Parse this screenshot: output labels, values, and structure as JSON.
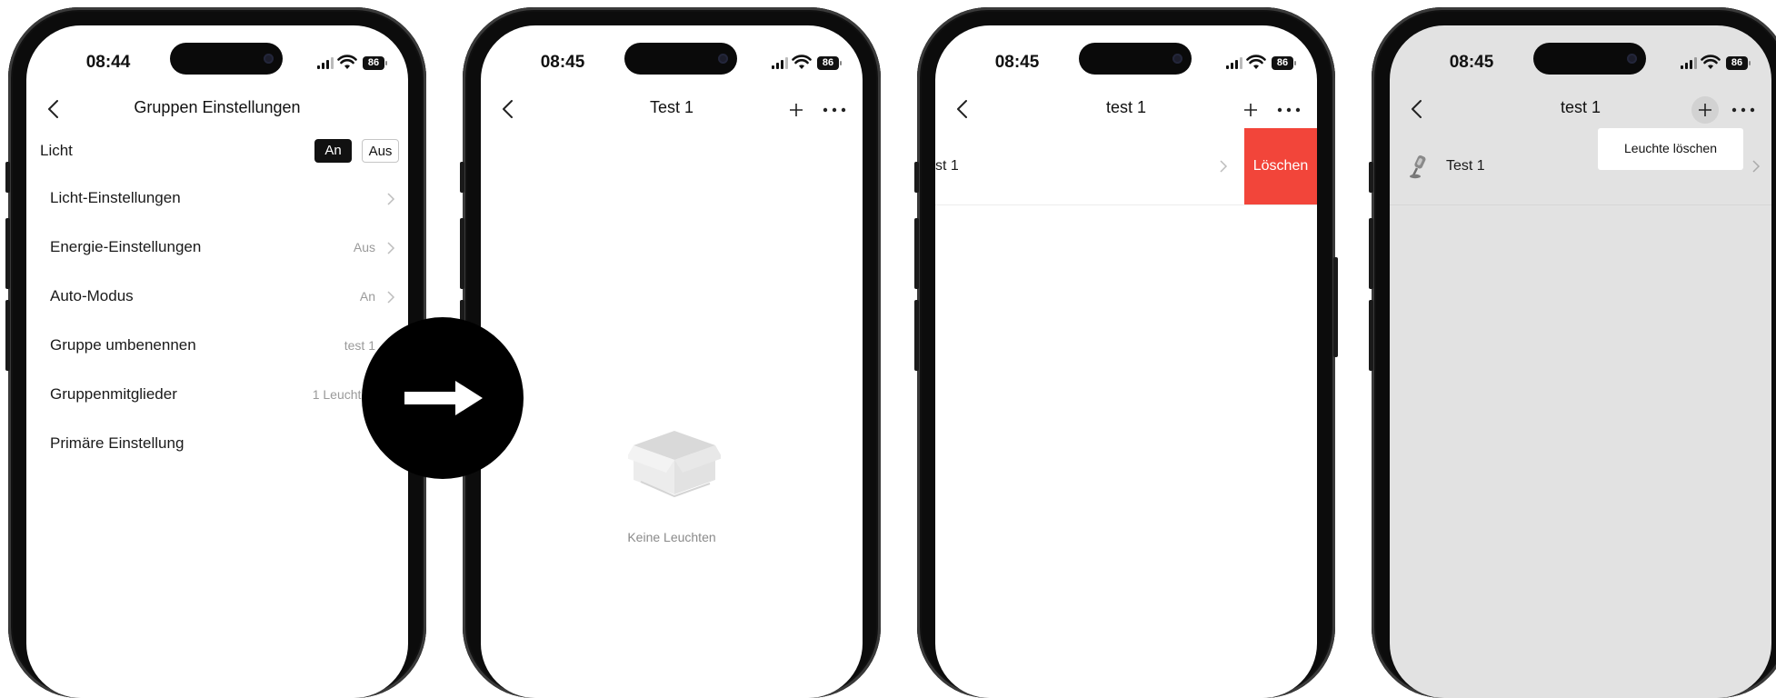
{
  "phones": [
    {
      "time": "08:44",
      "battery": "86",
      "nav": {
        "title": "Gruppen Einstellungen"
      },
      "light_row": {
        "label": "Licht",
        "on_label": "An",
        "off_label": "Aus"
      },
      "settings": [
        {
          "label": "Licht-Einstellungen",
          "value": ""
        },
        {
          "label": "Energie-Einstellungen",
          "value": "Aus"
        },
        {
          "label": "Auto-Modus",
          "value": "An"
        },
        {
          "label": "Gruppe umbenennen",
          "value": "test 1"
        },
        {
          "label": "Gruppenmitglieder",
          "value": "1 Leuchten"
        },
        {
          "label": "Primäre Einstellung",
          "value": ""
        }
      ]
    },
    {
      "time": "08:45",
      "battery": "86",
      "nav": {
        "title": "Test 1"
      },
      "empty_state": {
        "text": "Keine Leuchten",
        "icon": "empty-box-icon"
      }
    },
    {
      "time": "08:45",
      "battery": "86",
      "nav": {
        "title": "test 1"
      },
      "list_item": {
        "label": "st 1",
        "delete_label": "Löschen"
      }
    },
    {
      "time": "08:45",
      "battery": "86",
      "nav": {
        "title": "test 1"
      },
      "list_item": {
        "label": "Test 1",
        "icon": "lamp-icon"
      },
      "popup_menu": {
        "item": "Leuchte löschen"
      }
    }
  ],
  "transition": {
    "icon": "arrow-right-icon"
  },
  "colors": {
    "delete_red": "#f2453a",
    "dim_background": "#e2e2e2",
    "accent_black": "#111111"
  }
}
